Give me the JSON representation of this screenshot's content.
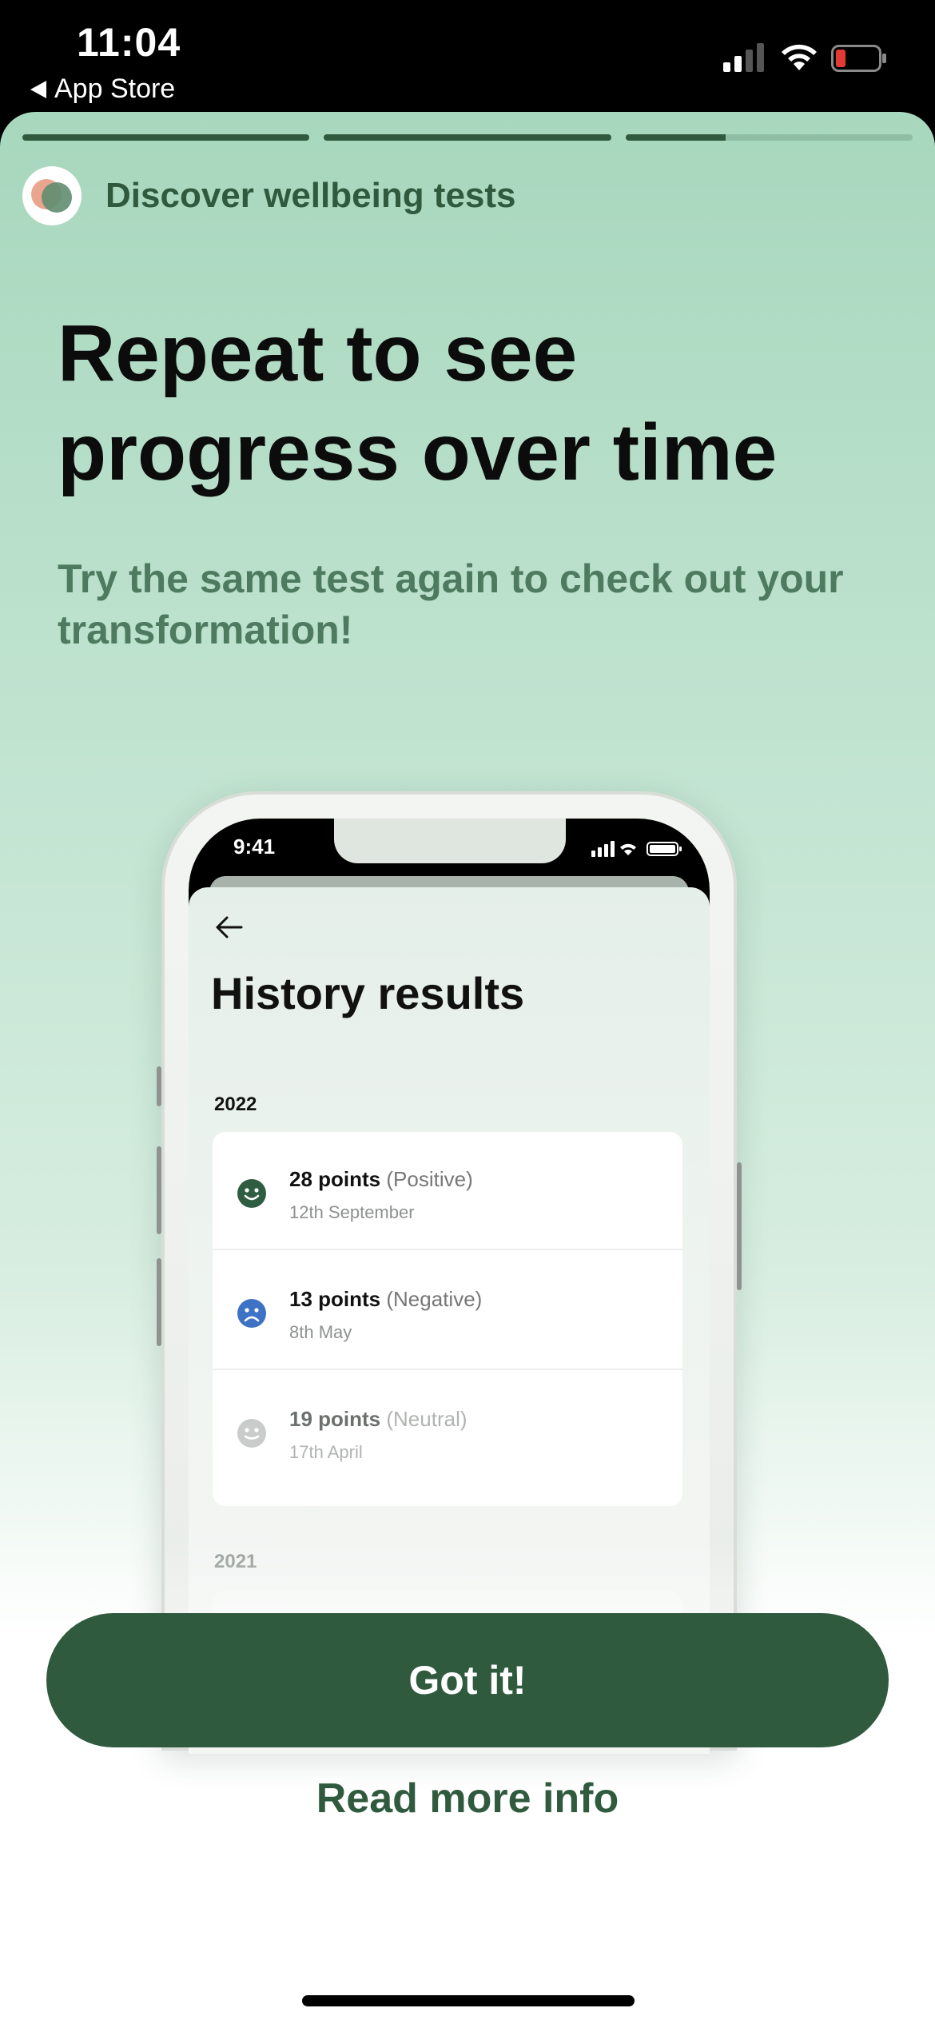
{
  "status_bar": {
    "time": "11:04",
    "back_label": "App Store"
  },
  "onboarding": {
    "progress_segments": [
      1.0,
      1.0,
      0.35
    ],
    "header_title": "Discover wellbeing tests",
    "headline": "Repeat to see progress over time",
    "subtitle": "Try the same test again to check out your transformation!"
  },
  "mockup": {
    "time": "9:41",
    "title": "History results",
    "groups": [
      {
        "year": "2022",
        "results": [
          {
            "points": "28 points",
            "sentiment": "(Positive)",
            "date": "12th September",
            "face": "happy-face-icon",
            "color": "#2f5d41"
          },
          {
            "points": "13 points",
            "sentiment": "(Negative)",
            "date": "8th May",
            "face": "sad-face-icon",
            "color": "#3d72c4"
          },
          {
            "points": "19 points",
            "sentiment": "(Neutral)",
            "date": "17th April",
            "face": "neutral-face-icon",
            "color": "#bfc3c0"
          }
        ]
      },
      {
        "year": "2021",
        "results": []
      }
    ]
  },
  "actions": {
    "primary_label": "Got it!",
    "secondary_label": "Read more info"
  },
  "colors": {
    "brand_dark_green": "#305a3e",
    "sheet_top": "#a7d7bd",
    "battery_low": "#e53935"
  }
}
